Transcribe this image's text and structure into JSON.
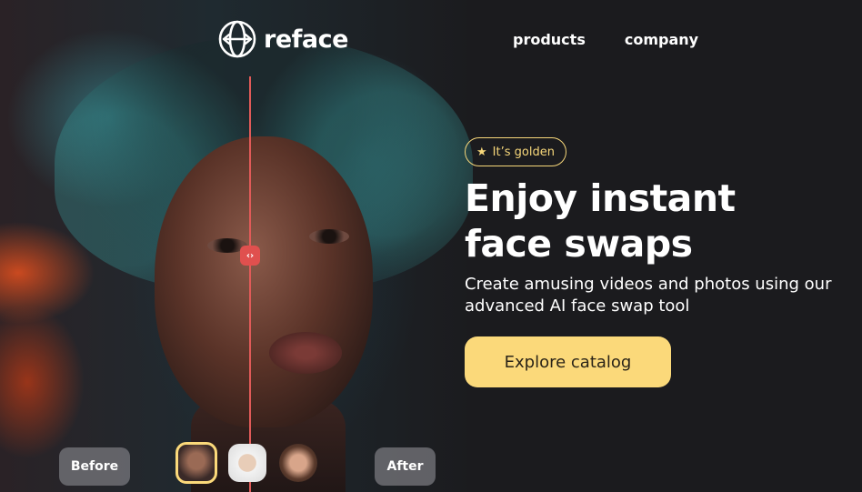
{
  "header": {
    "brand": "reface",
    "nav": [
      "products",
      "company"
    ]
  },
  "hero": {
    "badge": "It’s golden",
    "headline_line1": "Enjoy instant",
    "headline_line2": "face swaps",
    "subtitle_line1": "Create amusing videos and photos using our",
    "subtitle_line2": "advanced AI face swap tool",
    "cta": "Explore catalog"
  },
  "comparison": {
    "before_label": "Before",
    "after_label": "After",
    "slider_icon": "chevrons-left-right-icon"
  },
  "colors": {
    "background": "#1b1b1e",
    "accent": "#fbd97a",
    "divider": "#e05a58"
  }
}
